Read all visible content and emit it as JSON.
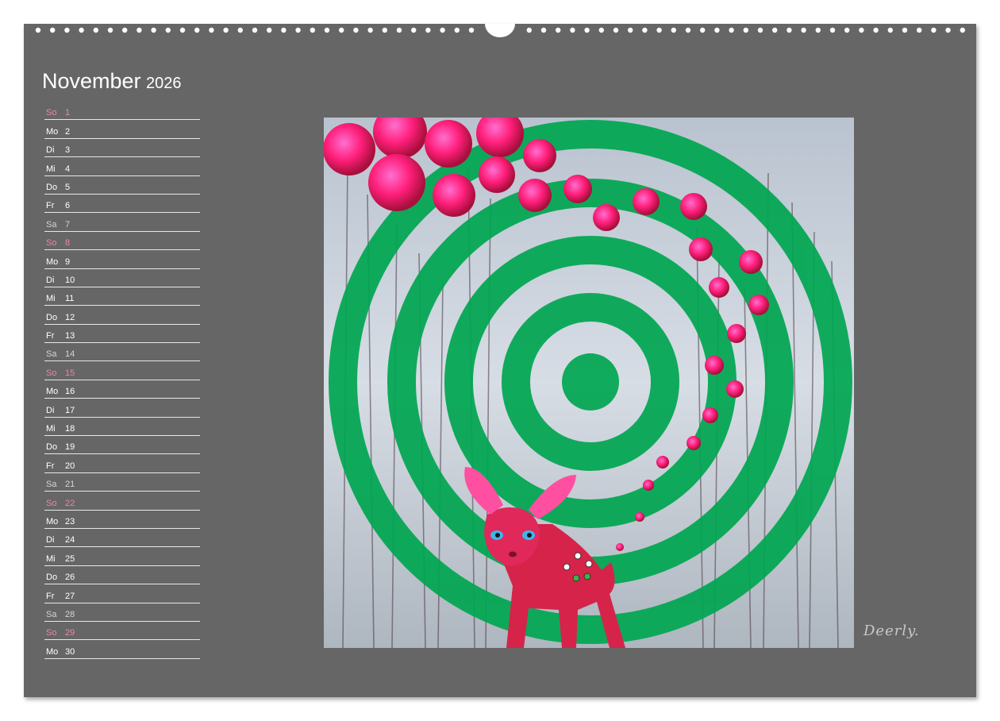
{
  "calendar": {
    "month": "November",
    "year": "2026",
    "days": [
      {
        "wd": "So",
        "d": "1"
      },
      {
        "wd": "Mo",
        "d": "2"
      },
      {
        "wd": "Di",
        "d": "3"
      },
      {
        "wd": "Mi",
        "d": "4"
      },
      {
        "wd": "Do",
        "d": "5"
      },
      {
        "wd": "Fr",
        "d": "6"
      },
      {
        "wd": "Sa",
        "d": "7"
      },
      {
        "wd": "So",
        "d": "8"
      },
      {
        "wd": "Mo",
        "d": "9"
      },
      {
        "wd": "Di",
        "d": "10"
      },
      {
        "wd": "Mi",
        "d": "11"
      },
      {
        "wd": "Do",
        "d": "12"
      },
      {
        "wd": "Fr",
        "d": "13"
      },
      {
        "wd": "Sa",
        "d": "14"
      },
      {
        "wd": "So",
        "d": "15"
      },
      {
        "wd": "Mo",
        "d": "16"
      },
      {
        "wd": "Di",
        "d": "17"
      },
      {
        "wd": "Mi",
        "d": "18"
      },
      {
        "wd": "Do",
        "d": "19"
      },
      {
        "wd": "Fr",
        "d": "20"
      },
      {
        "wd": "Sa",
        "d": "21"
      },
      {
        "wd": "So",
        "d": "22"
      },
      {
        "wd": "Mo",
        "d": "23"
      },
      {
        "wd": "Di",
        "d": "24"
      },
      {
        "wd": "Mi",
        "d": "25"
      },
      {
        "wd": "Do",
        "d": "26"
      },
      {
        "wd": "Fr",
        "d": "27"
      },
      {
        "wd": "Sa",
        "d": "28"
      },
      {
        "wd": "So",
        "d": "29"
      },
      {
        "wd": "Mo",
        "d": "30"
      }
    ]
  },
  "artwork": {
    "signature": "Deerly.",
    "ring_color": "#00a651",
    "bubble_color": "#ff1f7a",
    "background_color": "#c4ccd6"
  },
  "colors": {
    "page": "#666666",
    "sunday": "#e58aa6",
    "saturday": "#d4d4d4",
    "weekday": "#ffffff"
  }
}
